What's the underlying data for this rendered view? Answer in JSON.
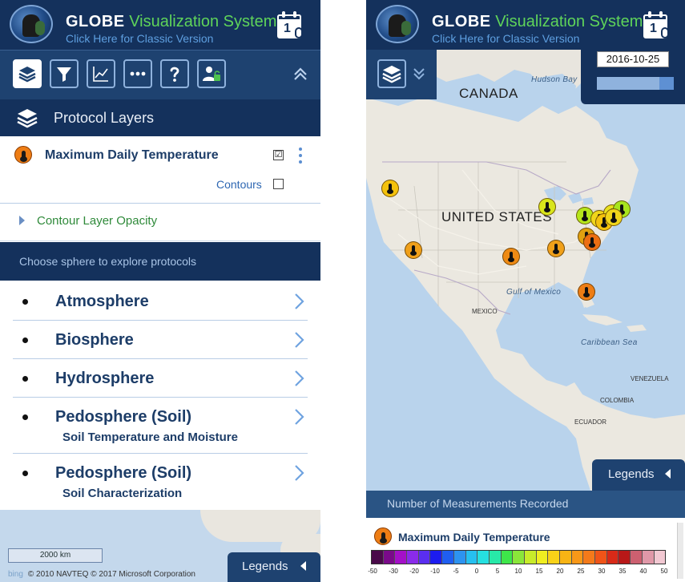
{
  "header": {
    "app_name_bold": "GLOBE",
    "app_name_rest": "Visualization System",
    "classic_link": "Click Here for Classic Version",
    "calendar_day": "1"
  },
  "toolbar": {
    "buttons": [
      "layers-icon",
      "filter-icon",
      "chart-icon",
      "more-icon",
      "help-icon",
      "user-lock-icon"
    ],
    "collapse_icon": "chevron-double-up-icon"
  },
  "protocol_layers": {
    "title": "Protocol Layers"
  },
  "active_layer": {
    "name": "Maximum Daily Temperature",
    "checked_symbol": "☑",
    "contours_label": "Contours",
    "contour_opacity_label": "Contour Layer Opacity",
    "icon_color": "#ee7d14"
  },
  "spheres": {
    "header": "Choose sphere to explore protocols",
    "items": [
      {
        "name": "Atmosphere",
        "sub": ""
      },
      {
        "name": "Biosphere",
        "sub": ""
      },
      {
        "name": "Hydrosphere",
        "sub": ""
      },
      {
        "name": "Pedosphere (Soil)",
        "sub": "Soil Temperature and Moisture"
      },
      {
        "name": "Pedosphere (Soil)",
        "sub": "Soil Characterization"
      }
    ]
  },
  "left_map": {
    "scale_label": "2000 km",
    "bing_label": "bing",
    "attribution": "© 2010 NAVTEQ © 2017 Microsoft Corporation",
    "legends_label": "Legends"
  },
  "right_map": {
    "date": "2016-10-25",
    "labels": {
      "canada": "CANADA",
      "us": "UNITED STATES",
      "mexico": "MEXICO",
      "hudson": "Hudson Bay",
      "gulf": "Gulf of Mexico",
      "caribbean": "Caribbean Sea",
      "venezuela": "VENEZUELA",
      "colombia": "COLOMBIA",
      "ecuador": "ECUADOR"
    },
    "legends_label": "Legends",
    "markers": [
      {
        "color": "#f4c20d"
      },
      {
        "color": "#f0a01a"
      },
      {
        "color": "#ee7d14"
      },
      {
        "color": "#d9e51b"
      },
      {
        "color": "#b5e61b"
      },
      {
        "color": "#a8e51e"
      },
      {
        "color": "#f0d51a"
      },
      {
        "color": "#e0a010"
      },
      {
        "color": "#ee8a14"
      },
      {
        "color": "#ec6e12"
      },
      {
        "color": "#f0a01a"
      }
    ]
  },
  "legend": {
    "measurements_label": "Number of Measurements Recorded",
    "layer_name": "Maximum Daily Temperature",
    "scale_colors": [
      "#4a0a4a",
      "#7a0a8a",
      "#a410c8",
      "#8a2bea",
      "#5a2ef0",
      "#1c1cf0",
      "#1f5ef0",
      "#2d93f0",
      "#26c0f0",
      "#26e0e0",
      "#28e8a8",
      "#3ee64a",
      "#8ae63a",
      "#c8ec2a",
      "#f0ee20",
      "#f8d218",
      "#f8b414",
      "#f89818",
      "#f47a1a",
      "#f05418",
      "#d82a18",
      "#b81818",
      "#cc6070",
      "#e098a8",
      "#f2c8d2"
    ],
    "scale_labels": [
      "-50",
      "-30",
      "-20",
      "-10",
      "-5",
      "0",
      "5",
      "10",
      "15",
      "20",
      "25",
      "30",
      "35",
      "40",
      "50"
    ]
  }
}
